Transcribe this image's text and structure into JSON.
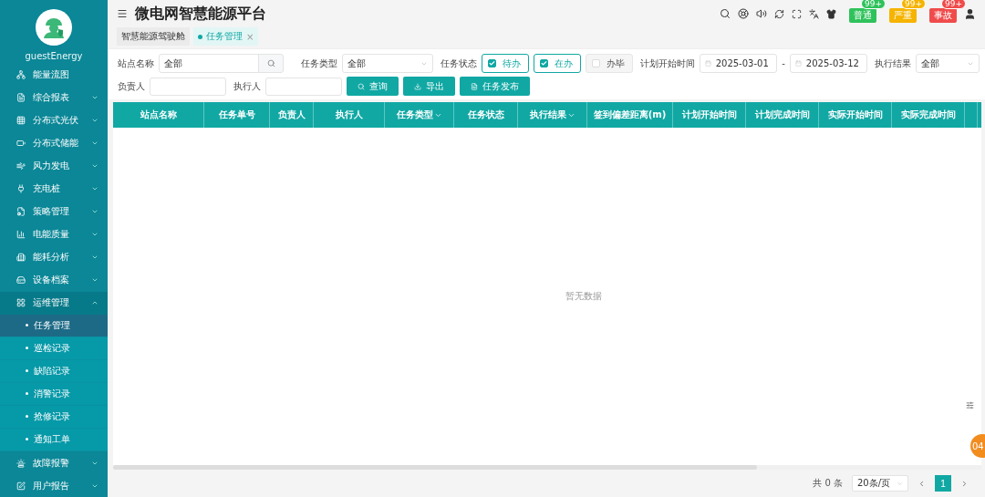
{
  "sidebar": {
    "username": "guestEnergy",
    "items": [
      {
        "label": "能量流图",
        "expandable": false,
        "expanded": false
      },
      {
        "label": "综合报表",
        "expandable": true,
        "expanded": false
      },
      {
        "label": "分布式光伏",
        "expandable": true,
        "expanded": false
      },
      {
        "label": "分布式储能",
        "expandable": true,
        "expanded": false
      },
      {
        "label": "风力发电",
        "expandable": true,
        "expanded": false
      },
      {
        "label": "充电桩",
        "expandable": true,
        "expanded": false
      },
      {
        "label": "策略管理",
        "expandable": true,
        "expanded": false
      },
      {
        "label": "电能质量",
        "expandable": true,
        "expanded": false
      },
      {
        "label": "能耗分析",
        "expandable": true,
        "expanded": false
      },
      {
        "label": "设备档案",
        "expandable": true,
        "expanded": false
      },
      {
        "label": "运维管理",
        "expandable": true,
        "expanded": true,
        "children": [
          {
            "label": "任务管理",
            "selected": true
          },
          {
            "label": "巡检记录",
            "selected": false
          },
          {
            "label": "缺陷记录",
            "selected": false
          },
          {
            "label": "消警记录",
            "selected": false
          },
          {
            "label": "抢修记录",
            "selected": false
          },
          {
            "label": "通知工单",
            "selected": false
          }
        ]
      },
      {
        "label": "故障报警",
        "expandable": true,
        "expanded": false
      },
      {
        "label": "用户报告",
        "expandable": true,
        "expanded": false
      }
    ]
  },
  "header": {
    "title": "微电网智慧能源平台",
    "alerts": [
      {
        "label": "普通",
        "count": "99+",
        "color": "#2fc25b"
      },
      {
        "label": "严重",
        "count": "99+",
        "color": "#f5b400"
      },
      {
        "label": "事故",
        "count": "99+",
        "color": "#f04b4b"
      }
    ]
  },
  "tabs": [
    {
      "label": "智慧能源驾驶舱",
      "selected": false,
      "closable": false
    },
    {
      "label": "任务管理",
      "selected": true,
      "closable": true,
      "close": "×"
    }
  ],
  "filters": {
    "station": {
      "label": "站点名称",
      "value": "全部"
    },
    "task_type": {
      "label": "任务类型",
      "value": "全部"
    },
    "status": {
      "label": "任务状态",
      "options": [
        {
          "label": "待办",
          "checked": true
        },
        {
          "label": "在办",
          "checked": true
        },
        {
          "label": "办毕",
          "checked": false
        }
      ]
    },
    "plan_start": {
      "label": "计划开始时间",
      "from": "2025-03-01",
      "separator": "-",
      "to": "2025-03-12"
    },
    "result": {
      "label": "执行结果",
      "value": "全部"
    },
    "owner": {
      "label": "负责人"
    },
    "executor": {
      "label": "执行人"
    },
    "buttons": [
      {
        "label": "查询",
        "kind": "search"
      },
      {
        "label": "导出",
        "kind": "export"
      },
      {
        "label": "任务发布",
        "kind": "publish"
      }
    ]
  },
  "table": {
    "columns": [
      {
        "label": "站点名称",
        "filter": false
      },
      {
        "label": "任务单号",
        "filter": false
      },
      {
        "label": "负责人",
        "filter": false
      },
      {
        "label": "执行人",
        "filter": false
      },
      {
        "label": "任务类型",
        "filter": true
      },
      {
        "label": "任务状态",
        "filter": false
      },
      {
        "label": "执行结果",
        "filter": true
      },
      {
        "label": "签到偏差距离(m)",
        "filter": false
      },
      {
        "label": "计划开始时间",
        "filter": false
      },
      {
        "label": "计划完成时间",
        "filter": false
      },
      {
        "label": "实际开始时间",
        "filter": false
      },
      {
        "label": "实际完成时间",
        "filter": false
      }
    ],
    "empty_text": "暂无数据"
  },
  "pagination": {
    "total": "共 0 条",
    "page_size": "20条/页",
    "pages": [
      {
        "label": "1",
        "selected": true
      }
    ]
  },
  "floating_badge": "04"
}
